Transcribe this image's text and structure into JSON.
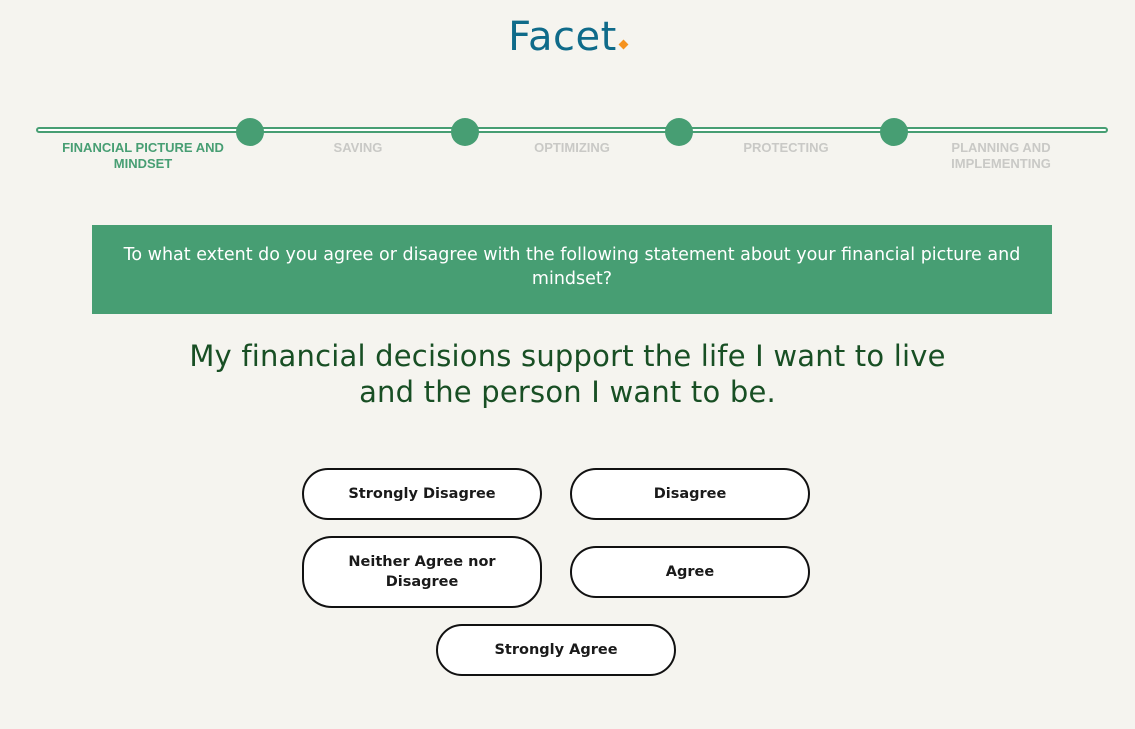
{
  "brand": {
    "name": "Facet",
    "logo_color": "#0f6b8a",
    "dot_color": "#f5921e"
  },
  "progress": {
    "accent_color": "#479e73",
    "inactive_color": "#c9c9c6",
    "current_step": 1,
    "steps": [
      {
        "label": "Financial Picture and Mindset",
        "active": true
      },
      {
        "label": "Saving",
        "active": false
      },
      {
        "label": "Optimizing",
        "active": false
      },
      {
        "label": "Protecting",
        "active": false
      },
      {
        "label": "Planning and Implementing",
        "active": false
      }
    ]
  },
  "question": {
    "prompt": "To what extent do you agree or disagree with the following statement about your financial picture and mindset?",
    "statement": "My financial decisions support the life I want to live and the person I want to be."
  },
  "answers": [
    {
      "label": "Strongly Disagree"
    },
    {
      "label": "Disagree"
    },
    {
      "label": "Neither Agree nor Disagree"
    },
    {
      "label": "Agree"
    },
    {
      "label": "Strongly Agree"
    }
  ],
  "colors": {
    "background": "#f5f4ef",
    "banner": "#479e73",
    "statement_text": "#184f24"
  }
}
